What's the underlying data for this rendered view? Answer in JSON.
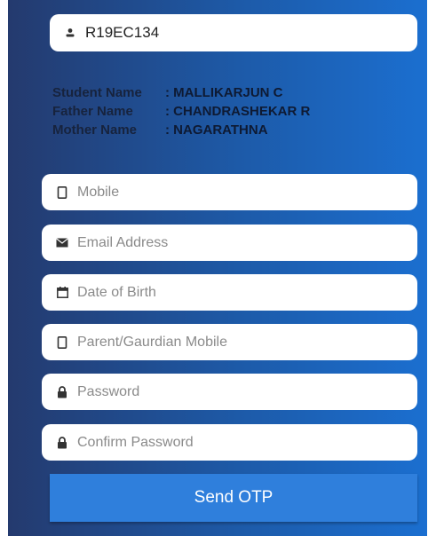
{
  "registration": {
    "value": "R19EC134",
    "icon": "user-icon"
  },
  "student_info": [
    {
      "label": "Student Name",
      "value": ": MALLIKARJUN C"
    },
    {
      "label": "Father Name",
      "value": ": CHANDRASHEKAR R"
    },
    {
      "label": "Mother Name",
      "value": ": NAGARATHNA"
    }
  ],
  "fields": {
    "mobile": {
      "placeholder": "Mobile",
      "icon": "mobile-icon"
    },
    "email": {
      "placeholder": "Email Address",
      "icon": "envelope-icon"
    },
    "dob": {
      "placeholder": "Date of Birth",
      "icon": "calendar-icon"
    },
    "parent_mobile": {
      "placeholder": "Parent/Gaurdian Mobile",
      "icon": "mobile-icon"
    },
    "password": {
      "placeholder": "Password",
      "icon": "lock-icon"
    },
    "confirm_password": {
      "placeholder": "Confirm Password",
      "icon": "lock-icon"
    }
  },
  "send_otp_label": "Send OTP",
  "colors": {
    "panel_start": "#243a6e",
    "panel_end": "#1b6fd0",
    "button": "#2f7fdc"
  }
}
